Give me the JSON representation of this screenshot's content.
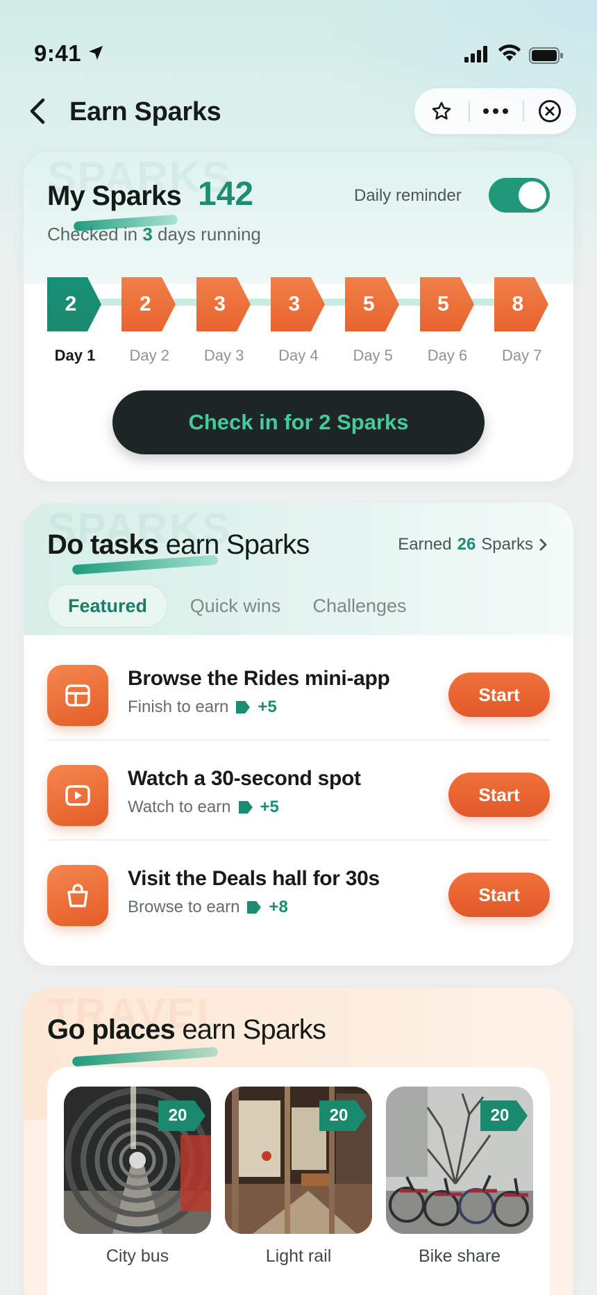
{
  "status_bar": {
    "time": "9:41"
  },
  "nav": {
    "title": "Earn Sparks"
  },
  "checkin_card": {
    "watermark": "SPARKS",
    "title": "My Sparks",
    "count": "142",
    "streak_prefix": "Checked in",
    "streak_days": "3",
    "streak_suffix": "days running",
    "reminder_label": "Daily reminder",
    "reminder_on": true,
    "days": [
      {
        "value": "2",
        "label": "Day 1",
        "active": true
      },
      {
        "value": "2",
        "label": "Day 2",
        "active": false
      },
      {
        "value": "3",
        "label": "Day 3",
        "active": false
      },
      {
        "value": "3",
        "label": "Day 4",
        "active": false
      },
      {
        "value": "5",
        "label": "Day 5",
        "active": false
      },
      {
        "value": "5",
        "label": "Day 6",
        "active": false
      },
      {
        "value": "8",
        "label": "Day 7",
        "active": false
      }
    ],
    "button_label": "Check in for 2 Sparks"
  },
  "tasks_card": {
    "watermark": "SPARKS",
    "title_bold": "Do tasks",
    "title_regular": "earn Sparks",
    "earned_prefix": "Earned",
    "earned_value": "26",
    "earned_suffix": "Sparks",
    "tabs": [
      {
        "label": "Featured",
        "active": true
      },
      {
        "label": "Quick wins",
        "active": false
      },
      {
        "label": "Challenges",
        "active": false
      }
    ],
    "tasks": [
      {
        "icon": "browser-icon",
        "title": "Browse the Rides mini-app",
        "subtitle": "Finish to earn",
        "points": "+5",
        "button": "Start"
      },
      {
        "icon": "play-icon",
        "title": "Watch a 30-second spot",
        "subtitle": "Watch to earn",
        "points": "+5",
        "button": "Start"
      },
      {
        "icon": "shopping-bag-icon",
        "title": "Visit the Deals hall for 30s",
        "subtitle": "Browse to earn",
        "points": "+8",
        "button": "Start"
      }
    ]
  },
  "travel_card": {
    "watermark": "TRAVEL",
    "title_bold": "Go places",
    "title_regular": "earn Sparks",
    "places": [
      {
        "label": "City bus",
        "points": "20",
        "image": "bus-tunnel-photo"
      },
      {
        "label": "Light rail",
        "points": "20",
        "image": "rail-carriage-photo"
      },
      {
        "label": "Bike share",
        "points": "20",
        "image": "bike-rack-photo"
      }
    ]
  },
  "colors": {
    "accent_green": "#1c8d72",
    "accent_orange": "#e8622e",
    "button_dark": "#1d2624"
  }
}
